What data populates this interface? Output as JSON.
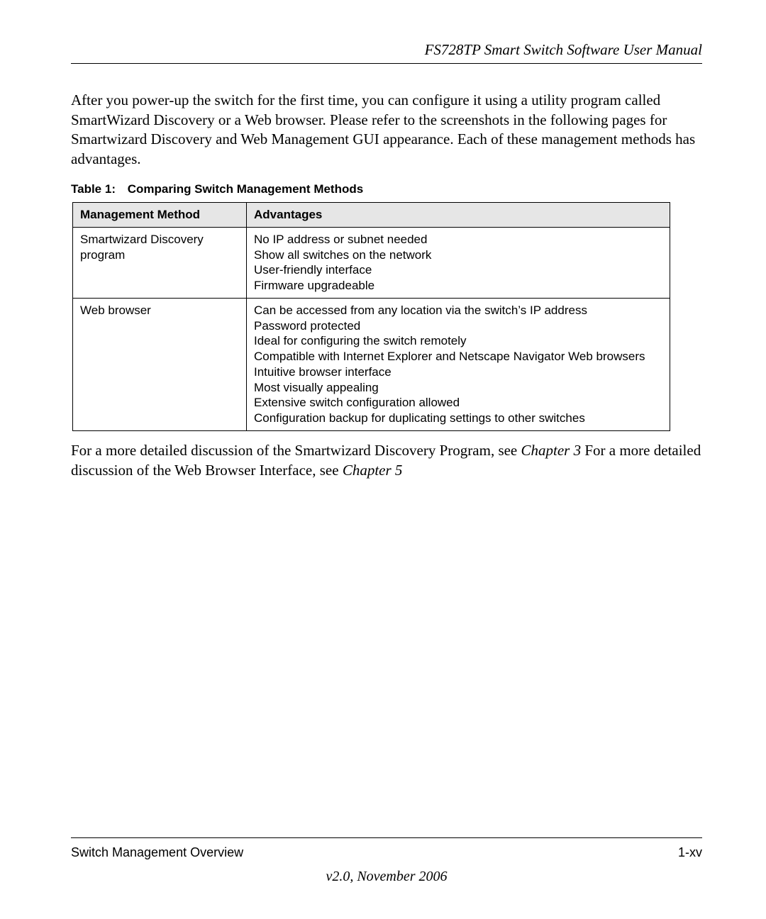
{
  "header": {
    "title": "FS728TP Smart Switch Software User Manual"
  },
  "intro": "After you power-up the switch for the first time, you can configure it using a utility program called SmartWizard Discovery or a Web browser. Please refer to the screenshots in the following pages for Smartwizard Discovery and Web Management GUI appearance. Each of these management methods has advantages.",
  "table": {
    "caption_label": "Table 1:",
    "caption_title": "Comparing Switch Management Methods",
    "headers": {
      "col1": "Management Method",
      "col2": "Advantages"
    },
    "rows": [
      {
        "method": "Smartwizard Discovery program",
        "advantages": [
          "No IP address or subnet needed",
          "Show all switches on the network",
          "User-friendly interface",
          "Firmware upgradeable"
        ]
      },
      {
        "method": "Web browser",
        "advantages": [
          "Can be accessed from any location via the switch’s IP address",
          "Password protected",
          "Ideal for configuring the switch remotely",
          "Compatible with Internet Explorer and Netscape Navigator Web browsers",
          "Intuitive browser interface",
          "Most visually appealing",
          "Extensive switch configuration allowed",
          "Configuration backup for duplicating settings to other switches"
        ]
      }
    ]
  },
  "after": {
    "part1": "For a more detailed discussion of the Smartwizard Discovery Program, see ",
    "ref1": "Chapter 3",
    "part2": " For a more detailed discussion of the Web Browser Interface, see ",
    "ref2": "Chapter 5"
  },
  "footer": {
    "section": "Switch Management Overview",
    "page": "1-xv",
    "version": "v2.0, November 2006"
  }
}
